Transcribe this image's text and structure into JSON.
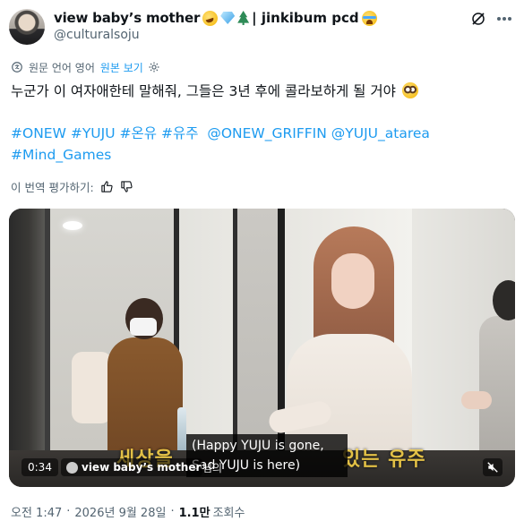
{
  "author": {
    "display_name": "view baby’s mother",
    "name_suffix": "| jinkibum pcd",
    "handle": "@culturalsoju"
  },
  "translation": {
    "source_label": "원문 언어 영어",
    "show_original": "원본 보기"
  },
  "tweet": {
    "text": "누군가 이 여자애한테 말해줘, 그들은 3년 후에 콜라보하게 될 거야",
    "hashtags_line1": [
      "#ONEW",
      "#YUJU",
      "#온유",
      "#유주"
    ],
    "mentions_line1": [
      "@ONEW_GRIFFIN",
      "@YUJU_atarea"
    ],
    "hashtags_line2": [
      "#Mind_Games"
    ]
  },
  "rate_translation": {
    "label": "이 번역 평가하기:"
  },
  "video": {
    "time": "0:34",
    "channel": "view baby’s mother ...",
    "channel_suffix": "님의",
    "caption_en": "(Happy YUJU is gone,\nSad YUJU is here)",
    "caption_ko_left": "세상을",
    "caption_ko_right": "있는 유주"
  },
  "footer": {
    "time": "오전 1:47",
    "date": "2026년 9월 28일",
    "views_count": "1.1만",
    "views_label": "조회수"
  },
  "colors": {
    "link": "#1d9bf0",
    "secondary_text": "#536471",
    "primary_text": "#0f1419"
  }
}
